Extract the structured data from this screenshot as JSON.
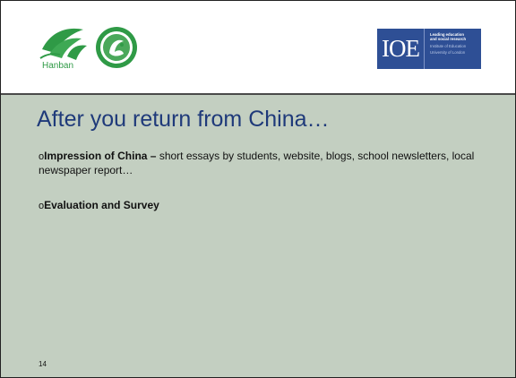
{
  "header": {
    "hanban_logo_text": "Hanban",
    "ioe_logo": {
      "mark": "IOE",
      "tagline_1": "Leading education",
      "tagline_2": "and social research",
      "institution_1": "Institute of Education",
      "institution_2": "University of London"
    }
  },
  "slide": {
    "title": "After you return from China…",
    "bullets": [
      {
        "marker": "o",
        "heading": "Impression of China –",
        "text": " short essays by students, website, blogs, school newsletters, local newspaper report…"
      },
      {
        "marker": "o",
        "heading": "Evaluation and Survey",
        "text": ""
      }
    ],
    "page_number": "14"
  },
  "colors": {
    "slide_background": "#c3cfc1",
    "title": "#1f3a7a",
    "hanban_green": "#2f9a46",
    "ioe_blue": "#2e4f95"
  }
}
